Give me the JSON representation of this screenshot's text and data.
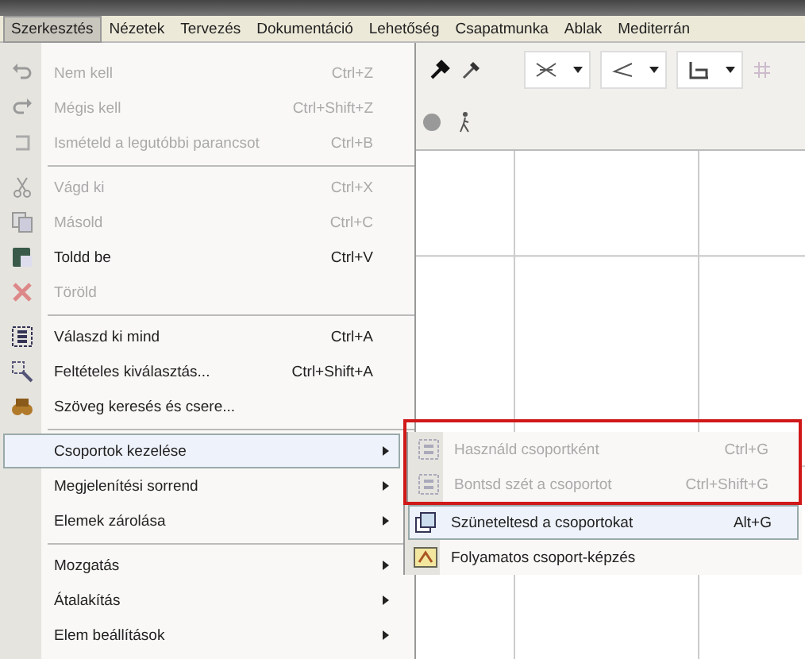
{
  "menubar": [
    {
      "label": "Szerkesztés",
      "selected": true
    },
    {
      "label": "Nézetek",
      "selected": false
    },
    {
      "label": "Tervezés",
      "selected": false
    },
    {
      "label": "Dokumentáció",
      "selected": false
    },
    {
      "label": "Lehetőség",
      "selected": false
    },
    {
      "label": "Csapatmunka",
      "selected": false
    },
    {
      "label": "Ablak",
      "selected": false
    },
    {
      "label": "Mediterrán",
      "selected": false
    }
  ],
  "menu": {
    "items": [
      {
        "kind": "item",
        "label": "Nem kell",
        "shortcut": "Ctrl+Z",
        "disabled": true,
        "submenu": false,
        "selected": false
      },
      {
        "kind": "item",
        "label": "Mégis kell",
        "shortcut": "Ctrl+Shift+Z",
        "disabled": true,
        "submenu": false,
        "selected": false
      },
      {
        "kind": "item",
        "label": "Ismételd a legutóbbi parancsot",
        "shortcut": "Ctrl+B",
        "disabled": true,
        "submenu": false,
        "selected": false
      },
      {
        "kind": "separator"
      },
      {
        "kind": "item",
        "label": "Vágd ki",
        "shortcut": "Ctrl+X",
        "disabled": true,
        "submenu": false,
        "selected": false
      },
      {
        "kind": "item",
        "label": "Másold",
        "shortcut": "Ctrl+C",
        "disabled": true,
        "submenu": false,
        "selected": false
      },
      {
        "kind": "item",
        "label": "Toldd be",
        "shortcut": "Ctrl+V",
        "disabled": false,
        "submenu": false,
        "selected": false
      },
      {
        "kind": "item",
        "label": "Töröld",
        "disabled": true,
        "submenu": false,
        "selected": false
      },
      {
        "kind": "separator"
      },
      {
        "kind": "item",
        "label": "Válaszd ki mind",
        "shortcut": "Ctrl+A",
        "disabled": false,
        "submenu": false,
        "selected": false
      },
      {
        "kind": "item",
        "label": "Feltételes kiválasztás...",
        "shortcut": "Ctrl+Shift+A",
        "disabled": false,
        "submenu": false,
        "selected": false
      },
      {
        "kind": "item",
        "label": "Szöveg keresés és csere...",
        "disabled": false,
        "submenu": false,
        "selected": false
      },
      {
        "kind": "separator"
      },
      {
        "kind": "item",
        "label": "Csoportok kezelése",
        "disabled": false,
        "submenu": true,
        "selected": true
      },
      {
        "kind": "item",
        "label": "Megjelenítési sorrend",
        "disabled": false,
        "submenu": true,
        "selected": false
      },
      {
        "kind": "item",
        "label": "Elemek zárolása",
        "disabled": false,
        "submenu": true,
        "selected": false
      },
      {
        "kind": "separator"
      },
      {
        "kind": "item",
        "label": "Mozgatás",
        "disabled": false,
        "submenu": true,
        "selected": false
      },
      {
        "kind": "item",
        "label": "Átalakítás",
        "disabled": false,
        "submenu": true,
        "selected": false
      },
      {
        "kind": "item",
        "label": "Elem beállítások",
        "disabled": false,
        "submenu": true,
        "selected": false
      }
    ]
  },
  "submenu": {
    "sections": [
      {
        "outlined": true,
        "items": [
          {
            "label": "Használd csoportként",
            "shortcut": "Ctrl+G",
            "disabled": true,
            "selected": false
          },
          {
            "label": "Bontsd szét a csoportot",
            "shortcut": "Ctrl+Shift+G",
            "disabled": true,
            "selected": false
          }
        ]
      },
      {
        "outlined": false,
        "items": [
          {
            "label": "Szüneteltesd a csoportokat",
            "shortcut": "Alt+G",
            "disabled": false,
            "selected": true
          },
          {
            "label": "Folyamatos csoport-képzés",
            "disabled": false,
            "selected": false
          }
        ]
      }
    ]
  }
}
